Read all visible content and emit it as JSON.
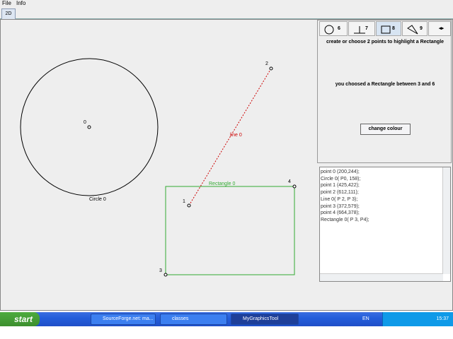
{
  "menu": [
    "File",
    "Info"
  ],
  "tab": "2D",
  "shapes": {
    "circle_label": "Circle 0",
    "circle_center_label": "0",
    "line_label": "line 0",
    "rect_label": "Rectangle 0",
    "points": [
      "1",
      "2",
      "3",
      "4"
    ]
  },
  "tool_tabs": [
    {
      "icon": "circle-icon",
      "label": "6"
    },
    {
      "icon": "perpendicular-icon",
      "label": "7"
    },
    {
      "icon": "rectangle-icon",
      "label": "8"
    },
    {
      "icon": "polygon-icon",
      "label": "9"
    }
  ],
  "hint": "create or choose 2 points to highlight a Rectangle",
  "chosen": "you choosed a Rectangle between 3 and 6",
  "change_colour": "change colour",
  "log": [
    "point 0 (200,244);",
    "Circle 0( P0, 158);",
    "point 1 (425,422);",
    "point 2 (612,111);",
    "Line 0( P 2, P 3);",
    "point 3 (372,579);",
    "point 4 (664,378);",
    "Rectangle 0( P 3, P4);"
  ],
  "taskbar": {
    "start": "start",
    "items": [
      "SourceForge.net: ma...",
      "classes",
      "MyGraphicsTool"
    ],
    "lang": "EN",
    "clock": "15:37"
  },
  "colors": {
    "line": "#cc0000",
    "rect": "#33aa33"
  }
}
